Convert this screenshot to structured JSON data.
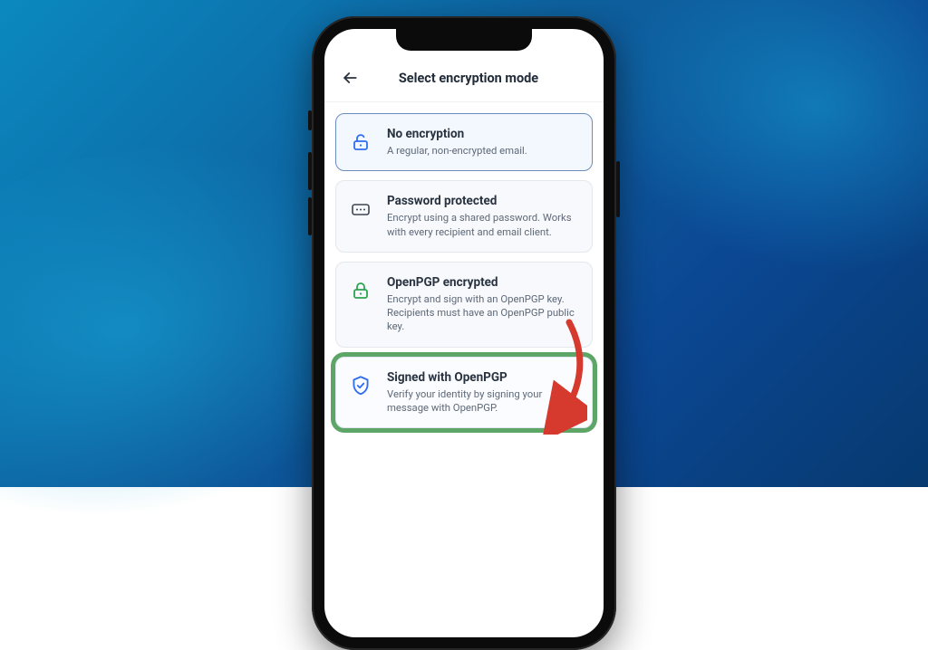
{
  "header": {
    "title": "Select encryption mode"
  },
  "options": [
    {
      "key": "none",
      "title": "No encryption",
      "desc": "A regular, non-encrypted email.",
      "icon": "unlock-icon",
      "selected": true,
      "highlighted": false
    },
    {
      "key": "password",
      "title": "Password protected",
      "desc": "Encrypt using a shared password. Works with every recipient and email client.",
      "icon": "password-icon",
      "selected": false,
      "highlighted": false
    },
    {
      "key": "openpgp",
      "title": "OpenPGP encrypted",
      "desc": "Encrypt and sign with an OpenPGP key. Recipients must have an OpenPGP public key.",
      "icon": "lock-green-icon",
      "selected": false,
      "highlighted": false
    },
    {
      "key": "signed",
      "title": "Signed with OpenPGP",
      "desc": "Verify your identity by signing your message with OpenPGP.",
      "icon": "shield-check-icon",
      "selected": false,
      "highlighted": true
    }
  ],
  "colors": {
    "accent": "#2f6df0",
    "green": "#2da44e",
    "annotation": "#d63a2f",
    "highlight": "#5ea668"
  }
}
